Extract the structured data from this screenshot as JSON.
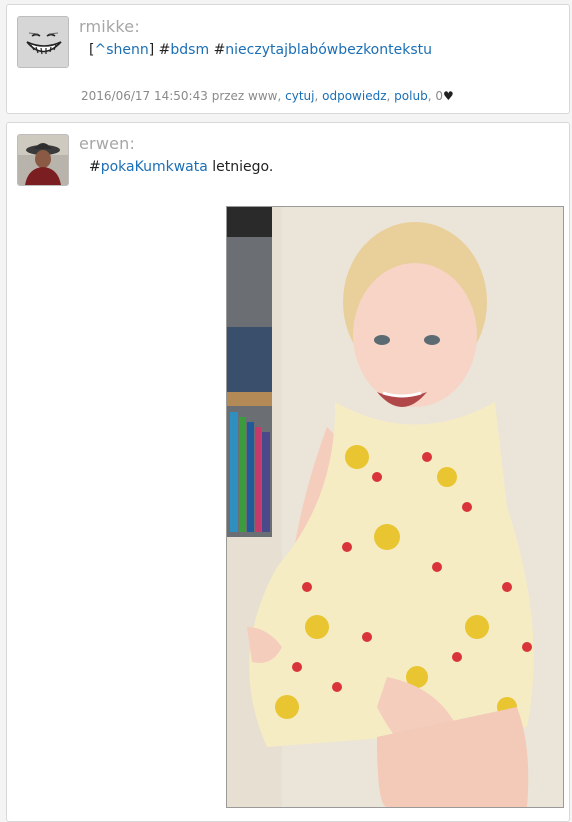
{
  "post1": {
    "author": "rmikke:",
    "content": {
      "bracket_open": "[",
      "mention": "^shenn",
      "bracket_close": "]",
      "hash1": "#",
      "tag1": "bdsm",
      "hash2": "#",
      "tag2": "nieczytajblabówbezkontekstu"
    },
    "meta": {
      "timestamp": "2016/06/17 14:50:43",
      "via": "przez www,",
      "quote": "cytuj",
      "comma1": ",",
      "reply": "odpowiedz",
      "comma2": ",",
      "like": "polub",
      "comma3": ",",
      "likes_count": "0",
      "heart": "♥"
    },
    "avatar_icon": "grin-face-icon"
  },
  "post2": {
    "author": "erwen:",
    "content": {
      "hash": "#",
      "tag": "pokaKumkwata",
      "text": " letniego."
    },
    "avatar_icon": "person-hat-photo",
    "photo_icon": "child-photo"
  }
}
